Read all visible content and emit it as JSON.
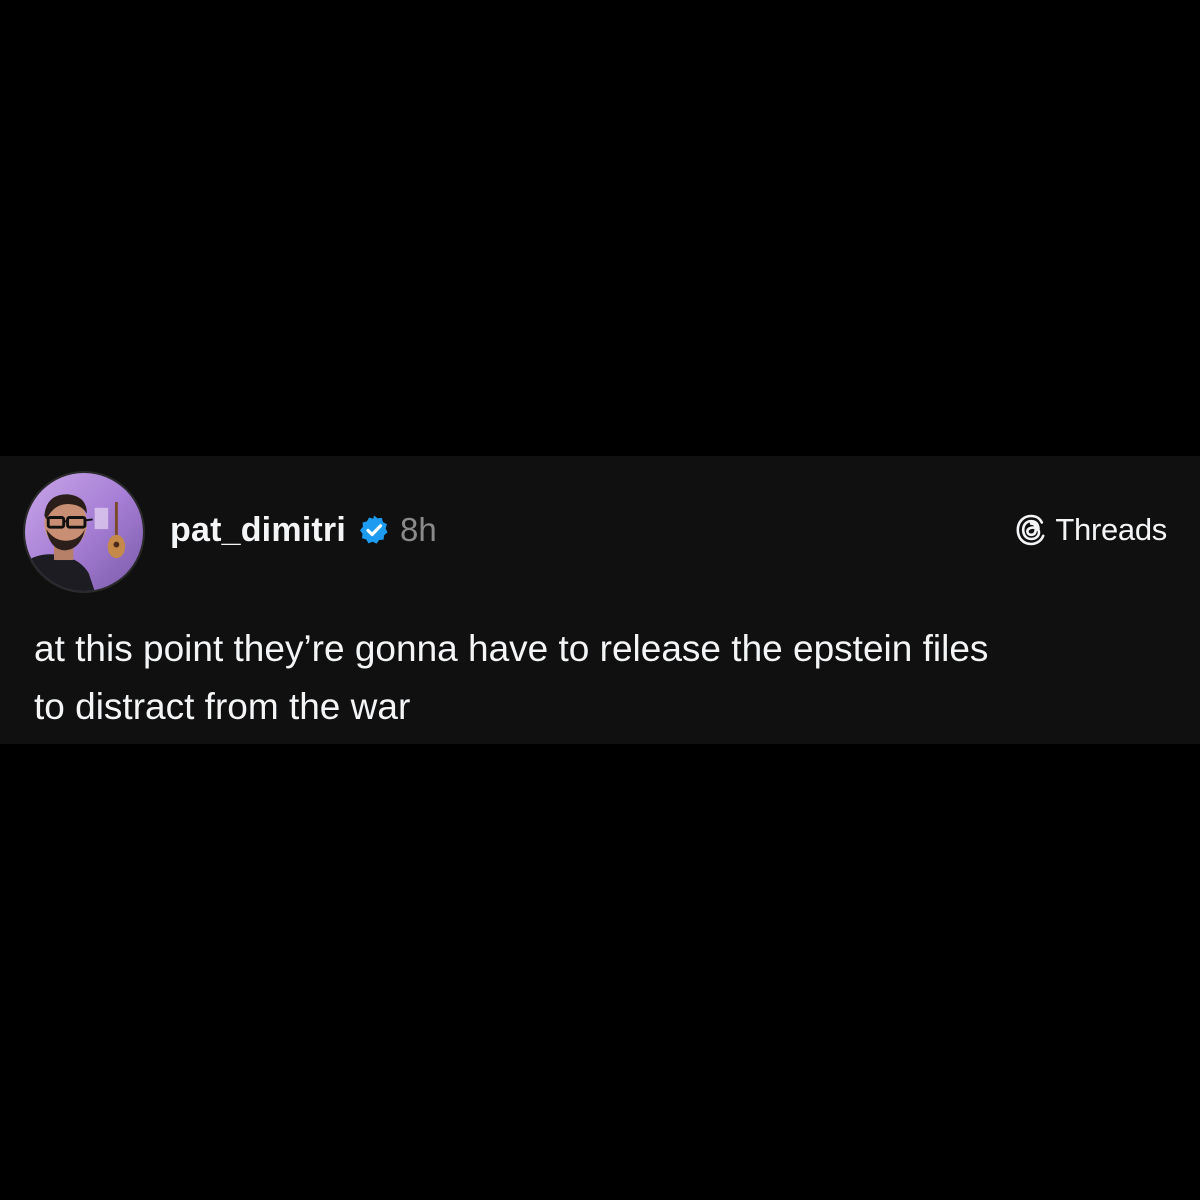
{
  "post": {
    "author": {
      "username": "pat_dimitri",
      "verified": true,
      "avatar_icon": "profile-photo"
    },
    "time": "8h",
    "platform": {
      "label": "Threads",
      "icon": "threads-logo-icon"
    },
    "text_lines": [
      "at this point they’re gonna have to release the epstein files",
      "to distract from the war"
    ]
  },
  "colors": {
    "page_background": "#000000",
    "card_background": "#101010",
    "primary_text": "#f3f5f7",
    "secondary_text": "#8a8a8a",
    "verified_blue": "#1d9bf0"
  }
}
